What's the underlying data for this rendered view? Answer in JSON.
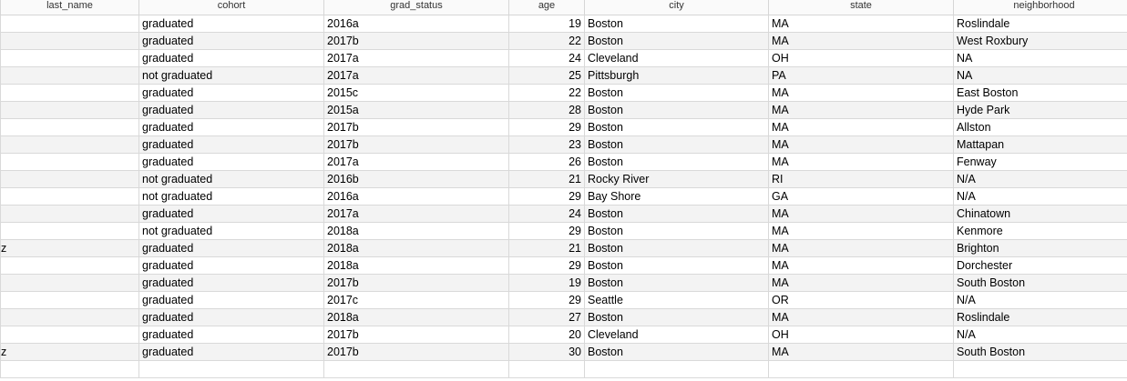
{
  "columns": [
    "last_name",
    "cohort",
    "grad_status",
    "age",
    "city",
    "state",
    "neighborhood"
  ],
  "rows": [
    {
      "last_name": "",
      "cohort": "graduated",
      "grad_status": "2016a",
      "age": "19",
      "city": "Boston",
      "state": "MA",
      "neighborhood": "Roslindale"
    },
    {
      "last_name": "",
      "cohort": "graduated",
      "grad_status": "2017b",
      "age": "22",
      "city": "Boston",
      "state": "MA",
      "neighborhood": "West Roxbury"
    },
    {
      "last_name": "",
      "cohort": "graduated",
      "grad_status": "2017a",
      "age": "24",
      "city": "Cleveland",
      "state": "OH",
      "neighborhood": "NA"
    },
    {
      "last_name": "",
      "cohort": "not graduated",
      "grad_status": "2017a",
      "age": "25",
      "city": "Pittsburgh",
      "state": "PA",
      "neighborhood": "NA"
    },
    {
      "last_name": "",
      "cohort": "graduated",
      "grad_status": "2015c",
      "age": "22",
      "city": "Boston",
      "state": "MA",
      "neighborhood": "East Boston"
    },
    {
      "last_name": "",
      "cohort": "graduated",
      "grad_status": "2015a",
      "age": "28",
      "city": "Boston",
      "state": "MA",
      "neighborhood": "Hyde Park"
    },
    {
      "last_name": "",
      "cohort": "graduated",
      "grad_status": "2017b",
      "age": "29",
      "city": "Boston",
      "state": "MA",
      "neighborhood": "Allston"
    },
    {
      "last_name": "",
      "cohort": "graduated",
      "grad_status": "2017b",
      "age": "23",
      "city": "Boston",
      "state": "MA",
      "neighborhood": "Mattapan"
    },
    {
      "last_name": "",
      "cohort": "graduated",
      "grad_status": "2017a",
      "age": "26",
      "city": "Boston",
      "state": "MA",
      "neighborhood": "Fenway"
    },
    {
      "last_name": "",
      "cohort": "not graduated",
      "grad_status": "2016b",
      "age": "21",
      "city": "Rocky River",
      "state": "RI",
      "neighborhood": "N/A"
    },
    {
      "last_name": "",
      "cohort": "not graduated",
      "grad_status": "2016a",
      "age": "29",
      "city": "Bay Shore",
      "state": "GA",
      "neighborhood": "N/A"
    },
    {
      "last_name": "",
      "cohort": "graduated",
      "grad_status": "2017a",
      "age": "24",
      "city": "Boston",
      "state": "MA",
      "neighborhood": "Chinatown"
    },
    {
      "last_name": "",
      "cohort": "not graduated",
      "grad_status": "2018a",
      "age": "29",
      "city": "Boston",
      "state": "MA",
      "neighborhood": "Kenmore"
    },
    {
      "last_name": "z",
      "cohort": "graduated",
      "grad_status": "2018a",
      "age": "21",
      "city": "Boston",
      "state": "MA",
      "neighborhood": "Brighton"
    },
    {
      "last_name": "",
      "cohort": "graduated",
      "grad_status": "2018a",
      "age": "29",
      "city": "Boston",
      "state": "MA",
      "neighborhood": "Dorchester"
    },
    {
      "last_name": "",
      "cohort": "graduated",
      "grad_status": "2017b",
      "age": "19",
      "city": "Boston",
      "state": "MA",
      "neighborhood": "South Boston"
    },
    {
      "last_name": "",
      "cohort": "graduated",
      "grad_status": "2017c",
      "age": "29",
      "city": "Seattle",
      "state": "OR",
      "neighborhood": "N/A"
    },
    {
      "last_name": "",
      "cohort": "graduated",
      "grad_status": "2018a",
      "age": "27",
      "city": "Boston",
      "state": "MA",
      "neighborhood": "Roslindale"
    },
    {
      "last_name": "",
      "cohort": "graduated",
      "grad_status": "2017b",
      "age": "20",
      "city": "Cleveland",
      "state": "OH",
      "neighborhood": "N/A"
    },
    {
      "last_name": "z",
      "cohort": "graduated",
      "grad_status": "2017b",
      "age": "30",
      "city": "Boston",
      "state": "MA",
      "neighborhood": "South Boston"
    }
  ],
  "empty_rows": 1,
  "colors": {
    "header_bg": "#fafafa",
    "row_alt_bg": "#f3f3f3",
    "grid_line": "#d9d9d9"
  }
}
